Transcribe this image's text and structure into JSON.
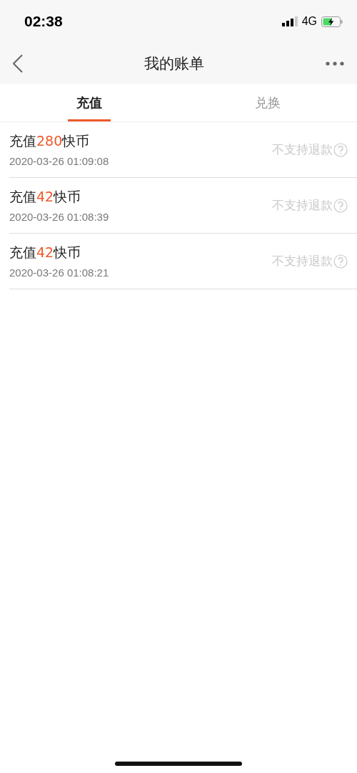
{
  "status_bar": {
    "time": "02:38",
    "network": "4G"
  },
  "nav_bar": {
    "title": "我的账单"
  },
  "tabs": [
    {
      "label": "充值",
      "selected": true
    },
    {
      "label": "兑换",
      "selected": false
    }
  ],
  "records": [
    {
      "prefix": "充值",
      "amount": "280",
      "suffix": "快币",
      "time": "2020-03-26 01:09:08",
      "refund_note": "不支持退款"
    },
    {
      "prefix": "充值",
      "amount": "42",
      "suffix": "快币",
      "time": "2020-03-26 01:08:39",
      "refund_note": "不支持退款"
    },
    {
      "prefix": "充值",
      "amount": "42",
      "suffix": "快币",
      "time": "2020-03-26 01:08:21",
      "refund_note": "不支持退款"
    }
  ]
}
